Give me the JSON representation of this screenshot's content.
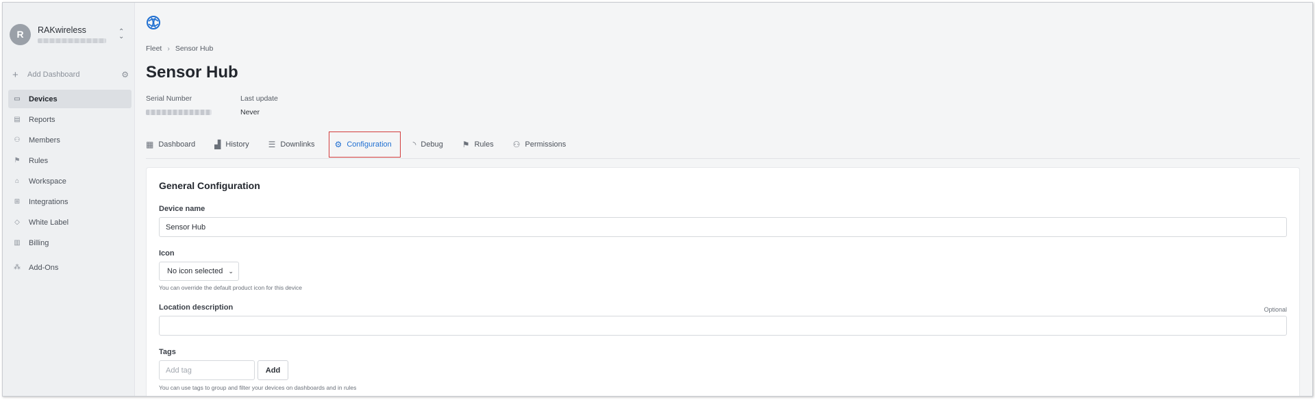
{
  "org": {
    "avatar_letter": "R",
    "name": "RAKwireless",
    "switch_icon": "chevron-updown-icon"
  },
  "sidebar": {
    "add_dashboard_label": "Add Dashboard",
    "items": [
      {
        "label": "Devices",
        "icon": "devices-icon",
        "active": true
      },
      {
        "label": "Reports",
        "icon": "report-icon"
      },
      {
        "label": "Members",
        "icon": "members-icon"
      },
      {
        "label": "Rules",
        "icon": "rules-icon"
      },
      {
        "label": "Workspace",
        "icon": "workspace-icon"
      },
      {
        "label": "Integrations",
        "icon": "integrations-icon"
      },
      {
        "label": "White Label",
        "icon": "tag-icon"
      },
      {
        "label": "Billing",
        "icon": "billing-icon"
      },
      {
        "label": "Add-Ons",
        "icon": "addons-icon"
      }
    ]
  },
  "breadcrumb": {
    "root": "Fleet",
    "current": "Sensor Hub"
  },
  "page_title": "Sensor Hub",
  "meta": {
    "serial_label": "Serial Number",
    "last_update_label": "Last update",
    "last_update_value": "Never"
  },
  "tabs": [
    {
      "label": "Dashboard",
      "icon": "dashboard-icon"
    },
    {
      "label": "History",
      "icon": "bar-chart-icon"
    },
    {
      "label": "Downlinks",
      "icon": "sliders-icon"
    },
    {
      "label": "Configuration",
      "icon": "gear-icon",
      "active": true
    },
    {
      "label": "Debug",
      "icon": "rss-icon"
    },
    {
      "label": "Rules",
      "icon": "rules-icon"
    },
    {
      "label": "Permissions",
      "icon": "people-icon"
    }
  ],
  "config": {
    "title": "General Configuration",
    "device_name_label": "Device name",
    "device_name_value": "Sensor Hub",
    "icon_label": "Icon",
    "icon_select_value": "No icon selected",
    "icon_hint": "You can override the default product icon for this device",
    "location_label": "Location description",
    "location_optional": "Optional",
    "location_value": "",
    "tags_label": "Tags",
    "tags_placeholder": "Add tag",
    "tags_add_button": "Add",
    "tags_hint": "You can use tags to group and filter your devices on dashboards and in rules"
  },
  "colors": {
    "accent": "#1f6fd1",
    "highlight_border": "#d23b3b"
  }
}
